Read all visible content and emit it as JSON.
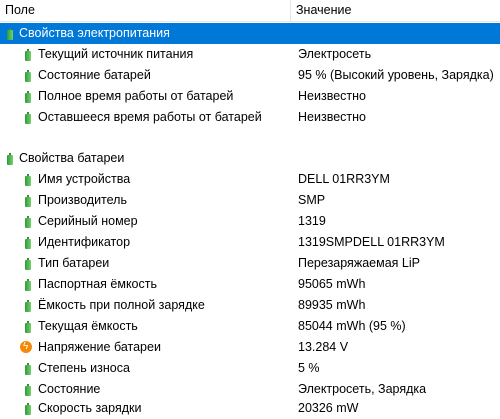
{
  "header": {
    "col_field": "Поле",
    "col_value": "Значение"
  },
  "sections": [
    {
      "title": "Свойства электропитания",
      "selected": true,
      "rows": [
        {
          "name": "Текущий источник питания",
          "value": "Электросеть",
          "icon": "battery-icon"
        },
        {
          "name": "Состояние батарей",
          "value": "95 % (Высокий уровень, Зарядка)",
          "icon": "battery-icon"
        },
        {
          "name": "Полное время работы от батарей",
          "value": "Неизвестно",
          "icon": "battery-icon"
        },
        {
          "name": "Оставшееся время работы от батарей",
          "value": "Неизвестно",
          "icon": "battery-icon"
        }
      ]
    },
    {
      "title": "Свойства батареи",
      "selected": false,
      "rows": [
        {
          "name": "Имя устройства",
          "value": "DELL 01RR3YM",
          "icon": "battery-icon"
        },
        {
          "name": "Производитель",
          "value": "SMP",
          "icon": "battery-icon"
        },
        {
          "name": "Серийный номер",
          "value": "1319",
          "icon": "battery-icon"
        },
        {
          "name": "Идентификатор",
          "value": "1319SMPDELL 01RR3YM",
          "icon": "battery-icon"
        },
        {
          "name": "Тип батареи",
          "value": "Перезаряжаемая LiP",
          "icon": "battery-icon"
        },
        {
          "name": "Паспортная ёмкость",
          "value": "95065 mWh",
          "icon": "battery-icon"
        },
        {
          "name": "Ёмкость при полной зарядке",
          "value": "89935 mWh",
          "icon": "battery-icon"
        },
        {
          "name": "Текущая ёмкость",
          "value": "85044 mWh  (95 %)",
          "icon": "battery-icon"
        },
        {
          "name": "Напряжение батареи",
          "value": "13.284 V",
          "icon": "voltage-icon"
        },
        {
          "name": "Степень износа",
          "value": "5 %",
          "icon": "battery-icon"
        },
        {
          "name": "Состояние",
          "value": "Электросеть, Зарядка",
          "icon": "battery-icon"
        },
        {
          "name": "Скорость зарядки",
          "value": "20326 mW",
          "icon": "battery-icon"
        }
      ]
    }
  ]
}
